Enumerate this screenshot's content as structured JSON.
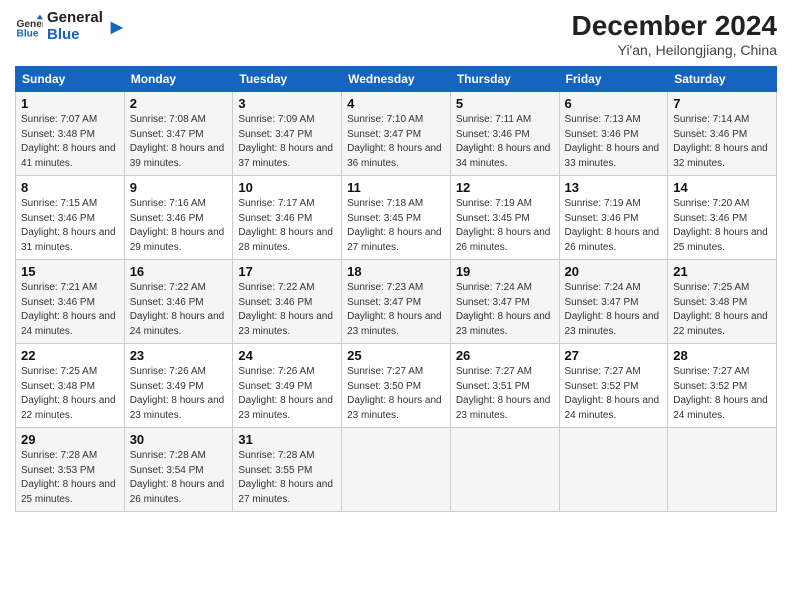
{
  "header": {
    "logo_line1": "General",
    "logo_line2": "Blue",
    "title": "December 2024",
    "subtitle": "Yi'an, Heilongjiang, China"
  },
  "weekdays": [
    "Sunday",
    "Monday",
    "Tuesday",
    "Wednesday",
    "Thursday",
    "Friday",
    "Saturday"
  ],
  "weeks": [
    [
      {
        "day": "1",
        "sunrise": "7:07 AM",
        "sunset": "3:48 PM",
        "daylight": "8 hours and 41 minutes."
      },
      {
        "day": "2",
        "sunrise": "7:08 AM",
        "sunset": "3:47 PM",
        "daylight": "8 hours and 39 minutes."
      },
      {
        "day": "3",
        "sunrise": "7:09 AM",
        "sunset": "3:47 PM",
        "daylight": "8 hours and 37 minutes."
      },
      {
        "day": "4",
        "sunrise": "7:10 AM",
        "sunset": "3:47 PM",
        "daylight": "8 hours and 36 minutes."
      },
      {
        "day": "5",
        "sunrise": "7:11 AM",
        "sunset": "3:46 PM",
        "daylight": "8 hours and 34 minutes."
      },
      {
        "day": "6",
        "sunrise": "7:13 AM",
        "sunset": "3:46 PM",
        "daylight": "8 hours and 33 minutes."
      },
      {
        "day": "7",
        "sunrise": "7:14 AM",
        "sunset": "3:46 PM",
        "daylight": "8 hours and 32 minutes."
      }
    ],
    [
      {
        "day": "8",
        "sunrise": "7:15 AM",
        "sunset": "3:46 PM",
        "daylight": "8 hours and 31 minutes."
      },
      {
        "day": "9",
        "sunrise": "7:16 AM",
        "sunset": "3:46 PM",
        "daylight": "8 hours and 29 minutes."
      },
      {
        "day": "10",
        "sunrise": "7:17 AM",
        "sunset": "3:46 PM",
        "daylight": "8 hours and 28 minutes."
      },
      {
        "day": "11",
        "sunrise": "7:18 AM",
        "sunset": "3:45 PM",
        "daylight": "8 hours and 27 minutes."
      },
      {
        "day": "12",
        "sunrise": "7:19 AM",
        "sunset": "3:45 PM",
        "daylight": "8 hours and 26 minutes."
      },
      {
        "day": "13",
        "sunrise": "7:19 AM",
        "sunset": "3:46 PM",
        "daylight": "8 hours and 26 minutes."
      },
      {
        "day": "14",
        "sunrise": "7:20 AM",
        "sunset": "3:46 PM",
        "daylight": "8 hours and 25 minutes."
      }
    ],
    [
      {
        "day": "15",
        "sunrise": "7:21 AM",
        "sunset": "3:46 PM",
        "daylight": "8 hours and 24 minutes."
      },
      {
        "day": "16",
        "sunrise": "7:22 AM",
        "sunset": "3:46 PM",
        "daylight": "8 hours and 24 minutes."
      },
      {
        "day": "17",
        "sunrise": "7:22 AM",
        "sunset": "3:46 PM",
        "daylight": "8 hours and 23 minutes."
      },
      {
        "day": "18",
        "sunrise": "7:23 AM",
        "sunset": "3:47 PM",
        "daylight": "8 hours and 23 minutes."
      },
      {
        "day": "19",
        "sunrise": "7:24 AM",
        "sunset": "3:47 PM",
        "daylight": "8 hours and 23 minutes."
      },
      {
        "day": "20",
        "sunrise": "7:24 AM",
        "sunset": "3:47 PM",
        "daylight": "8 hours and 23 minutes."
      },
      {
        "day": "21",
        "sunrise": "7:25 AM",
        "sunset": "3:48 PM",
        "daylight": "8 hours and 22 minutes."
      }
    ],
    [
      {
        "day": "22",
        "sunrise": "7:25 AM",
        "sunset": "3:48 PM",
        "daylight": "8 hours and 22 minutes."
      },
      {
        "day": "23",
        "sunrise": "7:26 AM",
        "sunset": "3:49 PM",
        "daylight": "8 hours and 23 minutes."
      },
      {
        "day": "24",
        "sunrise": "7:26 AM",
        "sunset": "3:49 PM",
        "daylight": "8 hours and 23 minutes."
      },
      {
        "day": "25",
        "sunrise": "7:27 AM",
        "sunset": "3:50 PM",
        "daylight": "8 hours and 23 minutes."
      },
      {
        "day": "26",
        "sunrise": "7:27 AM",
        "sunset": "3:51 PM",
        "daylight": "8 hours and 23 minutes."
      },
      {
        "day": "27",
        "sunrise": "7:27 AM",
        "sunset": "3:52 PM",
        "daylight": "8 hours and 24 minutes."
      },
      {
        "day": "28",
        "sunrise": "7:27 AM",
        "sunset": "3:52 PM",
        "daylight": "8 hours and 24 minutes."
      }
    ],
    [
      {
        "day": "29",
        "sunrise": "7:28 AM",
        "sunset": "3:53 PM",
        "daylight": "8 hours and 25 minutes."
      },
      {
        "day": "30",
        "sunrise": "7:28 AM",
        "sunset": "3:54 PM",
        "daylight": "8 hours and 26 minutes."
      },
      {
        "day": "31",
        "sunrise": "7:28 AM",
        "sunset": "3:55 PM",
        "daylight": "8 hours and 27 minutes."
      },
      null,
      null,
      null,
      null
    ]
  ]
}
